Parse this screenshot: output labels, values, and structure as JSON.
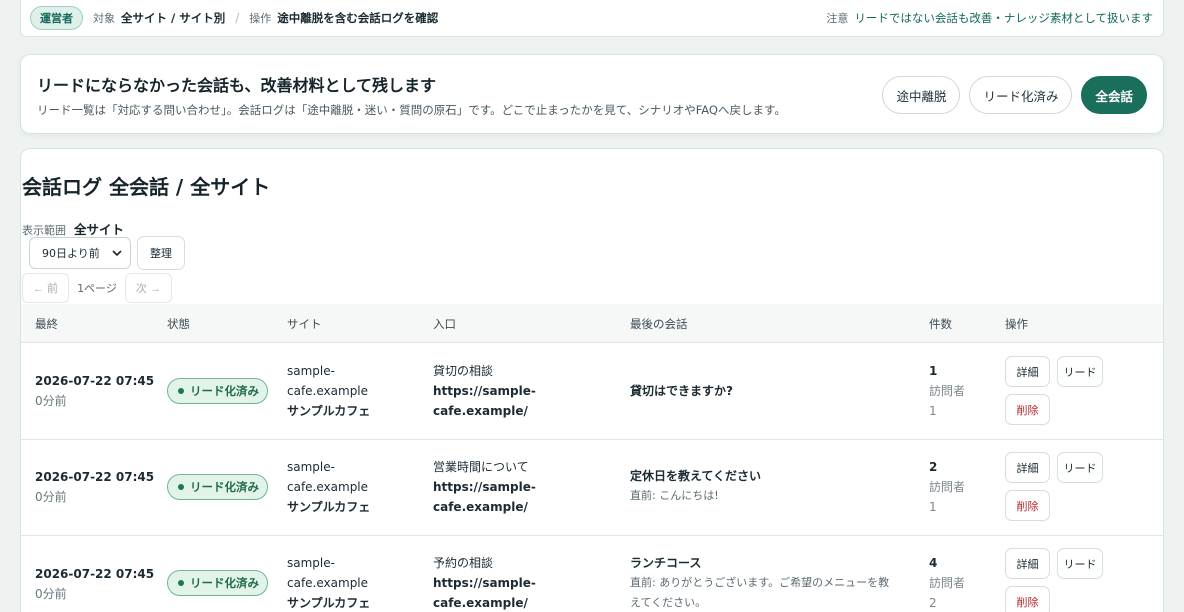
{
  "context_bar": {
    "role_badge": "運営者",
    "target_label": "対象",
    "target_value": "全サイト / サイト別",
    "separator": "/",
    "action_label": "操作",
    "action_value": "途中離脱を含む会話ログを確認",
    "note_label": "注意",
    "note_text": "リードではない会話も改善・ナレッジ素材として扱います"
  },
  "hero": {
    "title": "リードにならなかった会話も、改善材料として残します",
    "description": "リード一覧は「対応する問い合わせ」。会話ログは「途中離脱・迷い・質問の原石」です。どこで止まったかを見て、シナリオやFAQへ戻します。",
    "filters": [
      {
        "label": "途中離脱",
        "active": false
      },
      {
        "label": "リード化済み",
        "active": false
      },
      {
        "label": "全会話",
        "active": true
      }
    ]
  },
  "log": {
    "title": "会話ログ 全会話 / 全サイト",
    "range_label": "表示範囲",
    "range_value": "全サイト",
    "period_select_value": "90日より前",
    "organize_button": "整理",
    "pager": {
      "prev": "← 前",
      "info": "1ページ",
      "next": "次 →"
    },
    "columns": [
      "最終",
      "状態",
      "サイト",
      "入口",
      "最後の会話",
      "件数",
      "操作"
    ],
    "rows": [
      {
        "datetime": "2026-07-22 07:45",
        "ago": "0分前",
        "status": "リード化済み",
        "site_domain_1": "sample-",
        "site_domain_2": "cafe.example",
        "site_name": "サンプルカフェ",
        "entry_title": "貸切の相談",
        "entry_url_1": "https://sample-",
        "entry_url_2": "cafe.example/",
        "last_message": "貸切はできますか?",
        "prev_message": "",
        "count": "1",
        "visitors_label": "訪問者",
        "visitors": "1",
        "btn_detail": "詳細",
        "btn_lead": "リード",
        "btn_delete": "削除"
      },
      {
        "datetime": "2026-07-22 07:45",
        "ago": "0分前",
        "status": "リード化済み",
        "site_domain_1": "sample-",
        "site_domain_2": "cafe.example",
        "site_name": "サンプルカフェ",
        "entry_title": "営業時間について",
        "entry_url_1": "https://sample-",
        "entry_url_2": "cafe.example/",
        "last_message": "定休日を教えてください",
        "prev_message": "直前: こんにちは!",
        "count": "2",
        "visitors_label": "訪問者",
        "visitors": "1",
        "btn_detail": "詳細",
        "btn_lead": "リード",
        "btn_delete": "削除"
      },
      {
        "datetime": "2026-07-22 07:45",
        "ago": "0分前",
        "status": "リード化済み",
        "site_domain_1": "sample-",
        "site_domain_2": "cafe.example",
        "site_name": "サンプルカフェ",
        "entry_title": "予約の相談",
        "entry_url_1": "https://sample-",
        "entry_url_2": "cafe.example/",
        "last_message": "ランチコース",
        "prev_message": "直前: ありがとうございます。ご希望のメニューを教えてください。",
        "count": "4",
        "visitors_label": "訪問者",
        "visitors": "2",
        "btn_detail": "詳細",
        "btn_lead": "リード",
        "btn_delete": "削除"
      }
    ]
  },
  "colors": {
    "accent": "#1a6e5c",
    "status_green": "#1e6c45",
    "delete_red": "#b3262b",
    "page_bg": "#eef3f2"
  }
}
